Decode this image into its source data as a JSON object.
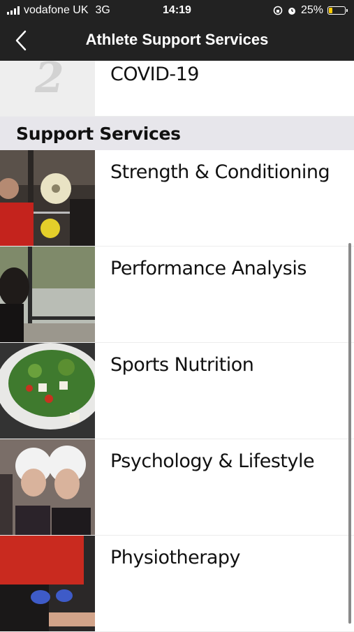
{
  "status_bar": {
    "carrier": "vodafone UK",
    "network": "3G",
    "time": "14:19",
    "battery_percent": "25%",
    "battery_level": 0.25,
    "icons": [
      "signal-icon",
      "orientation-lock-icon",
      "alarm-icon",
      "battery-icon"
    ]
  },
  "nav": {
    "title": "Athlete Support Services",
    "back_icon": "chevron-left-icon"
  },
  "list": {
    "top_item": {
      "label": "COVID-19"
    },
    "section_header": "Support Services",
    "items": [
      {
        "label": "Strength & Conditioning",
        "image": "weightlifting-photo"
      },
      {
        "label": "Performance Analysis",
        "image": "analysis-photo"
      },
      {
        "label": "Sports Nutrition",
        "image": "salad-photo"
      },
      {
        "label": "Psychology & Lifestyle",
        "image": "water-polo-photo"
      },
      {
        "label": "Physiotherapy",
        "image": "physio-photo"
      }
    ]
  },
  "colors": {
    "bar_background": "#222222",
    "section_background": "#e7e6eb",
    "battery_fill": "#ffcc00"
  }
}
